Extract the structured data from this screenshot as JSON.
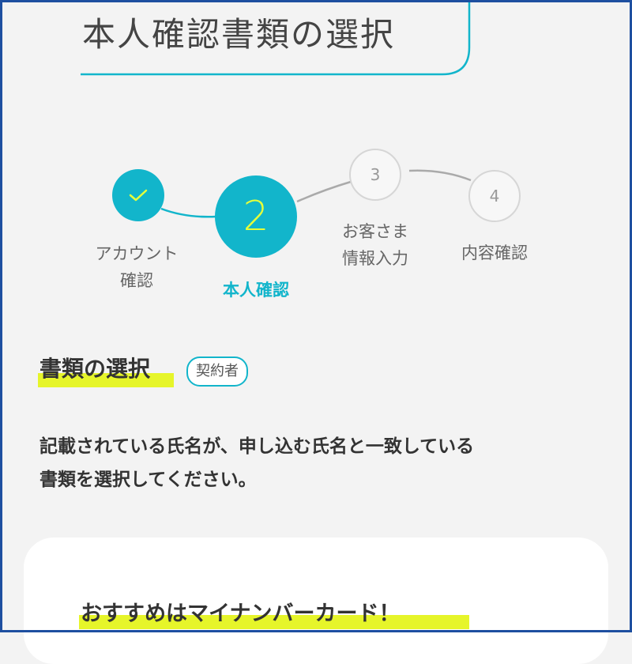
{
  "header": {
    "title": "本人確認書類の選択",
    "accent_color": "#12b5cb"
  },
  "stepper": {
    "steps": [
      {
        "status": "done",
        "icon": "checkmark-icon",
        "label_lines": [
          "アカウント",
          "確認"
        ]
      },
      {
        "status": "current",
        "number": "2",
        "label_lines": [
          "本人確認"
        ]
      },
      {
        "status": "upcoming",
        "number": "3",
        "label_lines": [
          "お客さま",
          "情報入力"
        ]
      },
      {
        "status": "upcoming",
        "number": "4",
        "label_lines": [
          "内容確認"
        ]
      }
    ],
    "current_number_color": "#e6ff3a"
  },
  "section": {
    "title": "書類の選択",
    "badge": "契約者",
    "description_lines": [
      "記載されている氏名が、申し込む氏名と一致している",
      "書類を選択してください。"
    ],
    "highlight_color": "#e6f52a"
  },
  "card": {
    "heading": "おすすめはマイナンバーカード！"
  }
}
